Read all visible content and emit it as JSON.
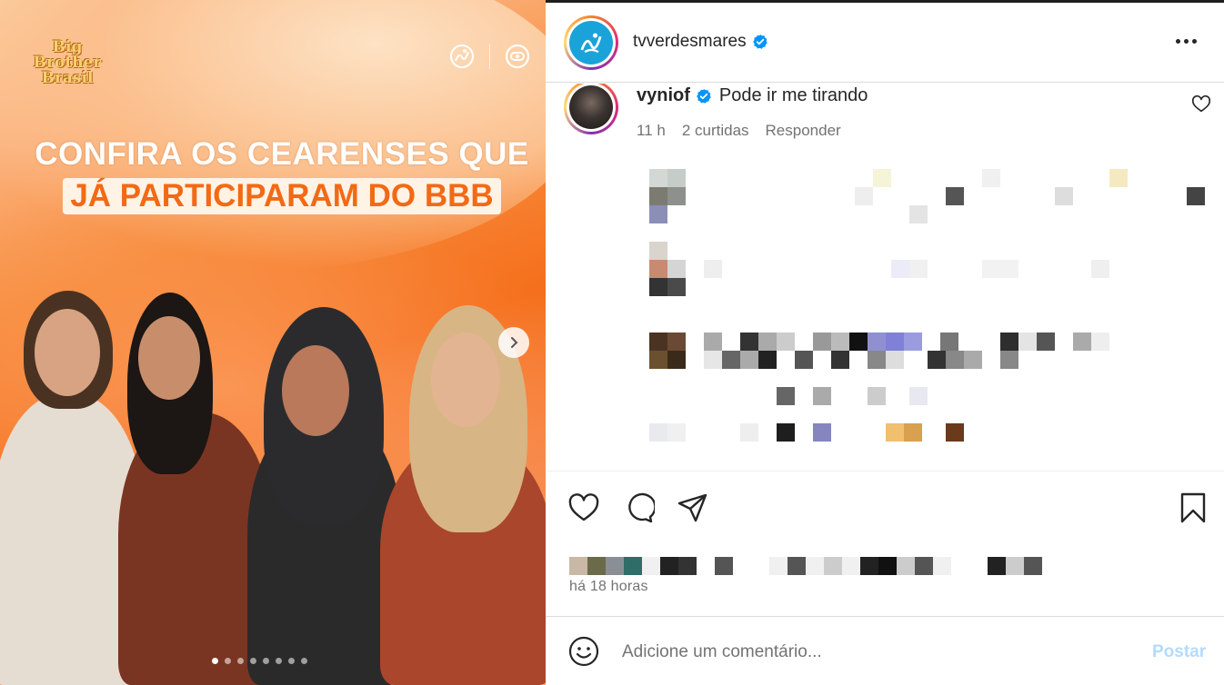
{
  "media": {
    "brand_logo_lines": [
      "Big Brother",
      "Brasil"
    ],
    "headline_line1": "CONFIRA OS CEARENSES QUE",
    "headline_line2": "JÁ PARTICIPARAM DO BBB",
    "carousel_dots": 8,
    "carousel_active_index": 0
  },
  "header": {
    "username": "tvverdesmares"
  },
  "comment": {
    "username": "vyniof",
    "text": "Pode ir me tirando",
    "time": "11 h",
    "likes": "2 curtidas",
    "reply_label": "Responder"
  },
  "post": {
    "timestamp": "há 18 horas"
  },
  "add_comment": {
    "placeholder": "Adicione um comentário...",
    "post_label": "Postar"
  },
  "icons": {
    "like": "heart-icon",
    "comment": "comment-bubble-icon",
    "share": "paper-plane-icon",
    "save": "bookmark-icon",
    "emoji": "smiley-icon",
    "more": "more-horizontal-icon",
    "verified": "verified-badge-icon"
  },
  "colors": {
    "verified": "#0095f6",
    "post_disabled": "#b3dbff",
    "meta_text": "#737373"
  }
}
